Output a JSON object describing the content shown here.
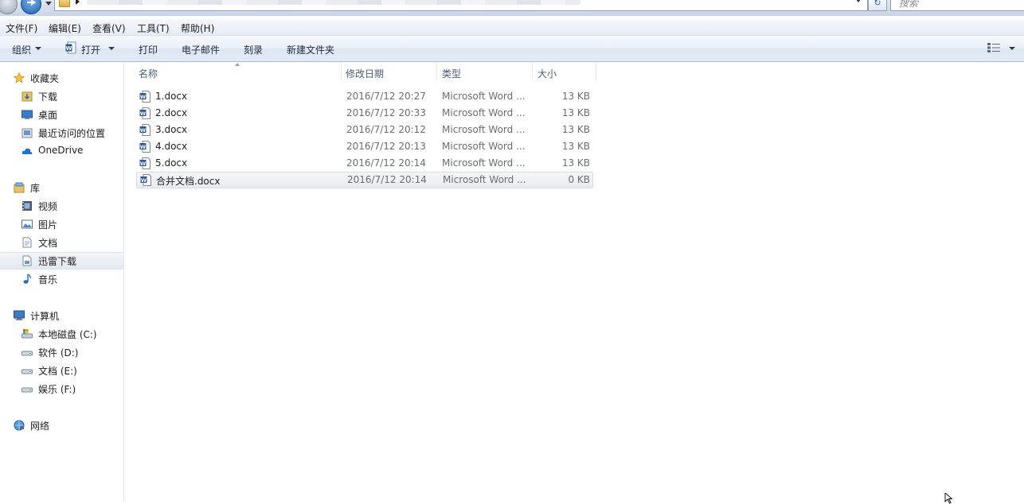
{
  "address": {
    "search_placeholder": "搜索"
  },
  "menu": {
    "items": [
      "文件(F)",
      "编辑(E)",
      "查看(V)",
      "工具(T)",
      "帮助(H)"
    ]
  },
  "toolbar": {
    "organize": "组织",
    "open": "打开",
    "print": "打印",
    "email": "电子邮件",
    "burn": "刻录",
    "new_folder": "新建文件夹"
  },
  "nav": {
    "favorites": {
      "label": "收藏夹",
      "items": [
        "下载",
        "桌面",
        "最近访问的位置",
        "OneDrive"
      ]
    },
    "libraries": {
      "label": "库",
      "items": [
        "视频",
        "图片",
        "文档",
        "迅雷下载",
        "音乐"
      ]
    },
    "computer": {
      "label": "计算机",
      "items": [
        "本地磁盘 (C:)",
        "软件 (D:)",
        "文档 (E:)",
        "娱乐 (F:)"
      ]
    },
    "network": {
      "label": "网络"
    }
  },
  "columns": {
    "name": "名称",
    "date": "修改日期",
    "type": "类型",
    "size": "大小"
  },
  "files": [
    {
      "name": "1.docx",
      "date": "2016/7/12 20:27",
      "type": "Microsoft Word ...",
      "size": "13 KB"
    },
    {
      "name": "2.docx",
      "date": "2016/7/12 20:33",
      "type": "Microsoft Word ...",
      "size": "13 KB"
    },
    {
      "name": "3.docx",
      "date": "2016/7/12 20:12",
      "type": "Microsoft Word ...",
      "size": "13 KB"
    },
    {
      "name": "4.docx",
      "date": "2016/7/12 20:13",
      "type": "Microsoft Word ...",
      "size": "13 KB"
    },
    {
      "name": "5.docx",
      "date": "2016/7/12 20:14",
      "type": "Microsoft Word ...",
      "size": "13 KB"
    },
    {
      "name": "合并文档.docx",
      "date": "2016/7/12 20:14",
      "type": "Microsoft Word ...",
      "size": "0 KB"
    }
  ],
  "colors": {
    "accent": "#2e63a8",
    "selection": "#e9ecef",
    "header_text": "#4c607a"
  }
}
